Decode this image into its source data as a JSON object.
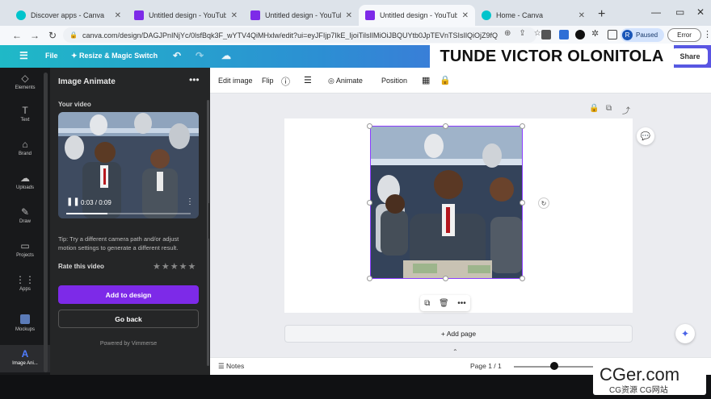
{
  "browser": {
    "tabs": [
      {
        "title": "Discover apps - Canva",
        "icon_color": "#00c4cc",
        "active": false
      },
      {
        "title": "Untitled design - YouTube Th",
        "icon_color": "#7d2ae8",
        "active": false
      },
      {
        "title": "Untitled design - YouTube Th",
        "icon_color": "#7d2ae8",
        "active": false
      },
      {
        "title": "Untitled design - YouTube Th",
        "icon_color": "#7d2ae8",
        "active": true
      },
      {
        "title": "Home - Canva",
        "icon_color": "#00c4cc",
        "active": false
      }
    ],
    "url": "canva.com/design/DAGJPnINjYc/0lsfBqk3F_wYTV4QiMHxlw/edit?ui=eyJFIjp7IkE_IjoiTilsIlMiOiJBQUYtb0JpTEVnTSIsIlQiOjZ9fQ",
    "profile_initial": "R",
    "profile_status": "Paused",
    "error_label": "Error"
  },
  "canva_header": {
    "file": "File",
    "resize": "Resize & Magic Switch",
    "share": "Share",
    "overlay_name": "TUNDE VICTOR OLONITOLA"
  },
  "rail": [
    {
      "label": "Elements",
      "icon": "elements-icon",
      "glyph": "◇"
    },
    {
      "label": "Text",
      "icon": "text-icon",
      "glyph": "T"
    },
    {
      "label": "Brand",
      "icon": "brand-icon",
      "glyph": "⌂"
    },
    {
      "label": "Uploads",
      "icon": "uploads-icon",
      "glyph": "☁"
    },
    {
      "label": "Draw",
      "icon": "draw-icon",
      "glyph": "✎"
    },
    {
      "label": "Projects",
      "icon": "projects-icon",
      "glyph": "▭"
    },
    {
      "label": "Apps",
      "icon": "apps-icon",
      "glyph": "⋮⋮"
    },
    {
      "label": "Mockups",
      "icon": "mockups-icon",
      "glyph": "▣"
    },
    {
      "label": "Image Ani...",
      "icon": "image-animate-icon",
      "glyph": "A"
    }
  ],
  "panel": {
    "title": "Image Animate",
    "section": "Your video",
    "video_time": "0:03 / 0:09",
    "progress": 0.33,
    "tip": "Tip: Try a different camera path and/or adjust motion settings to generate a different result.",
    "rate_label": "Rate this video",
    "stars": "★★★★★",
    "add_button": "Add to design",
    "back_button": "Go back",
    "powered_by": "Powered by Vimmerse"
  },
  "editor_toolbar": {
    "edit_image": "Edit image",
    "flip": "Flip",
    "animate": "Animate",
    "position": "Position"
  },
  "canvas": {
    "add_page": "+ Add page"
  },
  "footer": {
    "notes": "Notes",
    "pager": "Page 1 / 1",
    "zoom_fraction": 0.45
  },
  "watermark": {
    "main": "CGer.com",
    "sub": "CG资源 CG网站"
  },
  "colors": {
    "accent": "#7d2ae8",
    "header_start": "#1fb9c7",
    "header_end": "#5a54e3"
  }
}
